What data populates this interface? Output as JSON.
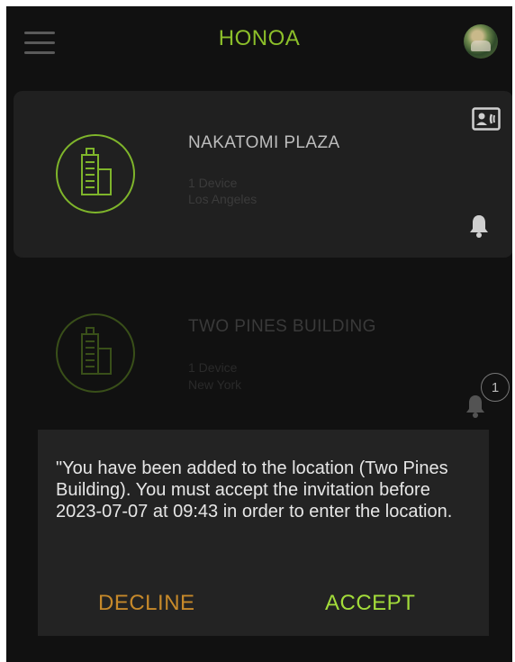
{
  "header": {
    "title": "HONOA",
    "menu_icon": "hamburger-menu-icon",
    "avatar_icon": "user-avatar"
  },
  "locations": [
    {
      "name": "NAKATOMI PLAZA",
      "devices": "1 Device",
      "city": "Los Angeles",
      "icon": "building-icon",
      "card_icon": "contact-card-icon",
      "notification_icon": "bell-icon"
    },
    {
      "name": "TWO PINES BUILDING",
      "devices": "1 Device",
      "city": "New York",
      "icon": "building-icon",
      "notification_icon": "bell-icon",
      "notification_count": "1"
    }
  ],
  "dialog": {
    "message": "\"You have been added to the location (Two Pines Building). You must accept the invitation before 2023-07-07 at 09:43 in order to enter the location.",
    "decline_label": "DECLINE",
    "accept_label": "ACCEPT"
  },
  "colors": {
    "accent": "#8cbf2a",
    "accept": "#a3dc3a",
    "decline": "#c6892a",
    "background": "#111111",
    "card": "#202020"
  }
}
